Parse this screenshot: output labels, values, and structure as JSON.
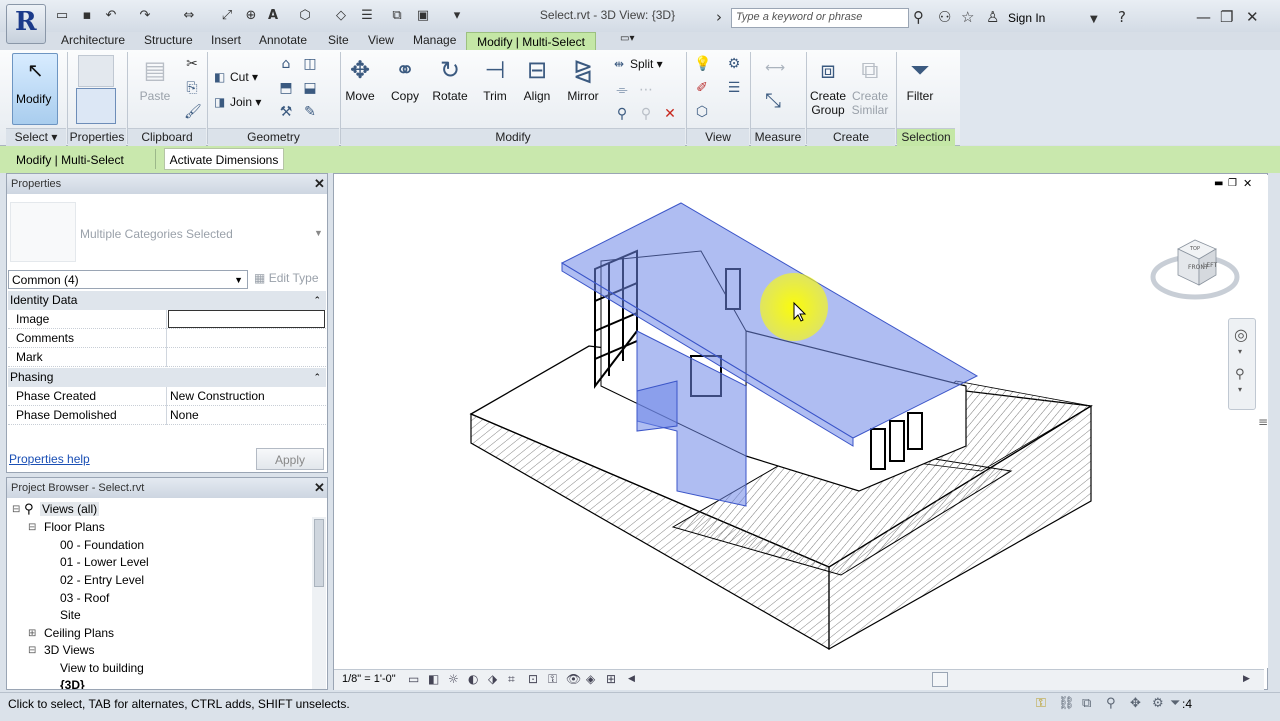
{
  "title_bar": {
    "document_title": "Select.rvt - 3D View: {3D}",
    "search_placeholder": "Type a keyword or phrase",
    "sign_in": "Sign In"
  },
  "tabs": [
    "Architecture",
    "Structure",
    "Insert",
    "Annotate",
    "Site",
    "View",
    "Manage"
  ],
  "active_tab": "Modify | Multi-Select",
  "ribbon": {
    "select": {
      "modify": "Modify",
      "panel": "Select"
    },
    "properties": {
      "panel": "Properties"
    },
    "clipboard": {
      "paste": "Paste",
      "panel": "Clipboard"
    },
    "geometry": {
      "cut": "Cut",
      "join": "Join",
      "panel": "Geometry"
    },
    "modify": {
      "move": "Move",
      "copy": "Copy",
      "rotate": "Rotate",
      "trim": "Trim",
      "align": "Align",
      "mirror": "Mirror",
      "split": "Split",
      "panel": "Modify"
    },
    "view": {
      "panel": "View"
    },
    "measure": {
      "panel": "Measure"
    },
    "create": {
      "create_group_1": "Create",
      "create_group_2": "Group",
      "create_similar_1": "Create",
      "create_similar_2": "Similar",
      "panel": "Create"
    },
    "selection": {
      "filter": "Filter",
      "panel": "Selection"
    }
  },
  "context_bar": {
    "label": "Modify | Multi-Select",
    "activate_dimensions": "Activate Dimensions"
  },
  "properties": {
    "header": "Properties",
    "type_name": "Multiple Categories Selected",
    "category_filter": "Common (4)",
    "edit_type": "Edit Type",
    "groups": [
      {
        "name": "Identity Data",
        "rows": [
          {
            "name": "Image",
            "value": ""
          },
          {
            "name": "Comments",
            "value": ""
          },
          {
            "name": "Mark",
            "value": ""
          }
        ]
      },
      {
        "name": "Phasing",
        "rows": [
          {
            "name": "Phase Created",
            "value": "New Construction"
          },
          {
            "name": "Phase Demolished",
            "value": "None"
          }
        ]
      }
    ],
    "help_link": "Properties help",
    "apply": "Apply"
  },
  "project_browser": {
    "header": "Project Browser - Select.rvt",
    "root": "Views (all)",
    "floor_plans": "Floor Plans",
    "floor_plan_items": [
      "00 - Foundation",
      "01 - Lower Level",
      "02 - Entry Level",
      "03 - Roof",
      "Site"
    ],
    "ceiling_plans": "Ceiling Plans",
    "views_3d": "3D Views",
    "views_3d_items": [
      "View to building",
      "{3D}"
    ]
  },
  "view_controls": {
    "scale": "1/8\" = 1'-0\""
  },
  "viewcube": {
    "front": "FRONT",
    "left": "LEFT",
    "top": "TOP"
  },
  "status_bar": {
    "message": "Click to select, TAB for alternates, CTRL adds, SHIFT unselects.",
    "filter_count": ":4"
  },
  "colors": {
    "selection_blue": "#6d86e8",
    "active_tab": "#c4e7a6",
    "context_bar": "#c9e8ad",
    "cursor_highlight": "#ffff00"
  }
}
